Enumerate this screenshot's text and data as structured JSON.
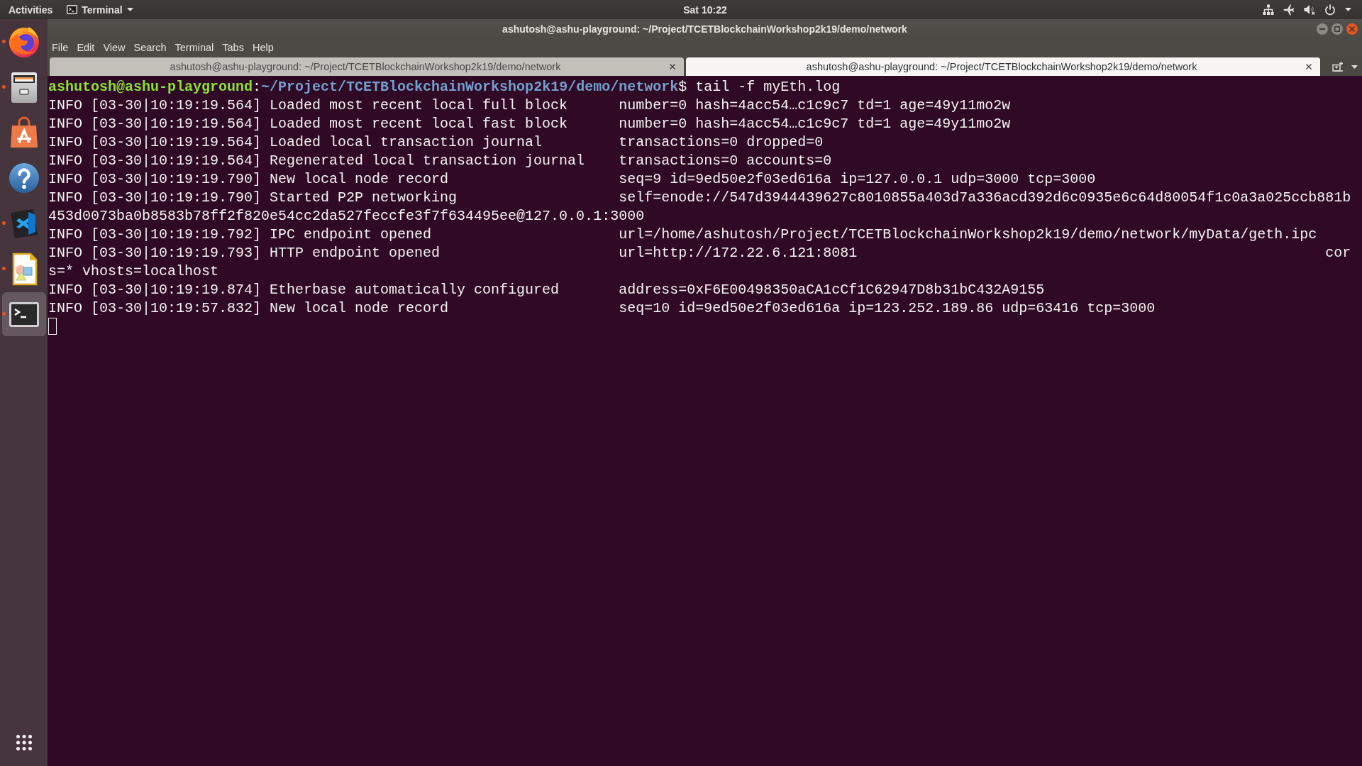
{
  "top_bar": {
    "activities": "Activities",
    "app_menu": "Terminal",
    "clock": "Sat 10:22",
    "status_icons": [
      {
        "kind": "network"
      },
      {
        "kind": "airplane"
      },
      {
        "kind": "volume",
        "muted": true
      },
      {
        "kind": "power"
      },
      {
        "kind": "menu_caret"
      }
    ]
  },
  "dock": {
    "items": [
      {
        "kind": "browser",
        "running": true,
        "selected": false
      },
      {
        "kind": "files",
        "running": true,
        "selected": false
      },
      {
        "kind": "software",
        "running": false,
        "selected": false
      },
      {
        "kind": "help",
        "running": false,
        "selected": false
      },
      {
        "kind": "code_editor",
        "running": true,
        "selected": false
      },
      {
        "kind": "draw",
        "running": true,
        "selected": false
      },
      {
        "kind": "terminal",
        "running": true,
        "selected": true
      }
    ]
  },
  "window": {
    "title": "ashutosh@ashu-playground: ~/Project/TCETBlockchainWorkshop2k19/demo/network",
    "menu": [
      "File",
      "Edit",
      "View",
      "Search",
      "Terminal",
      "Tabs",
      "Help"
    ],
    "tabs": [
      {
        "label": "ashutosh@ashu-playground: ~/Project/TCETBlockchainWorkshop2k19/demo/network",
        "selected": false
      },
      {
        "label": "ashutosh@ashu-playground: ~/Project/TCETBlockchainWorkshop2k19/demo/network",
        "selected": true
      }
    ],
    "terminal": {
      "prompt": {
        "user_host": "ashutosh@ashu-playground",
        "separator": ":",
        "path": "~/Project/TCETBlockchainWorkshop2k19/demo/network",
        "command": "$ tail -f myEth.log"
      },
      "lines": [
        "INFO [03-30|10:19:19.564] Loaded most recent local full block      number=0 hash=4acc54…c1c9c7 td=1 age=49y11mo2w",
        "INFO [03-30|10:19:19.564] Loaded most recent local fast block      number=0 hash=4acc54…c1c9c7 td=1 age=49y11mo2w",
        "INFO [03-30|10:19:19.564] Loaded local transaction journal         transactions=0 dropped=0",
        "INFO [03-30|10:19:19.564] Regenerated local transaction journal    transactions=0 accounts=0",
        "INFO [03-30|10:19:19.790] New local node record                    seq=9 id=9ed50e2f03ed616a ip=127.0.0.1 udp=3000 tcp=3000",
        "INFO [03-30|10:19:19.790] Started P2P networking                   self=enode://547d3944439627c8010855a403d7a336acd392d6c0935e6c64d80054f1c0a3a025ccb881b",
        "453d0073ba0b8583b78ff2f820e54cc2da527feccfe3f7f634495ee@127.0.0.1:3000",
        "INFO [03-30|10:19:19.792] IPC endpoint opened                      url=/home/ashutosh/Project/TCETBlockchainWorkshop2k19/demo/network/myData/geth.ipc",
        "INFO [03-30|10:19:19.793] HTTP endpoint opened                     url=http://172.22.6.121:8081                                                       cor",
        "s=* vhosts=localhost",
        "INFO [03-30|10:19:19.874] Etherbase automatically configured       address=0xF6E00498350aCA1cCf1C62947D8b31bC432A9155",
        "INFO [03-30|10:19:57.832] New local node record                    seq=10 id=9ed50e2f03ed616a ip=123.252.189.86 udp=63416 tcp=3000"
      ],
      "cursor_focused": false
    }
  }
}
